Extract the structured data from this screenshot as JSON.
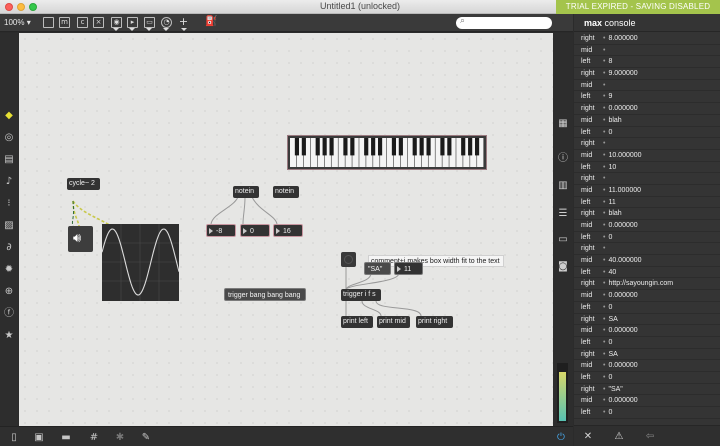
{
  "window": {
    "title": "Untitled1 (unlocked)",
    "trial_banner": "TRIAL EXPIRED - SAVING DISABLED"
  },
  "toolbar": {
    "zoom": "100%"
  },
  "patch": {
    "cycle": "cycle~ 2",
    "notein1": "notein",
    "notein2": "notein",
    "num1": "-8",
    "num2": "0",
    "num3": "16",
    "comment": "comment+j makes box width fit to the text",
    "msg_sa": "\"SA\"",
    "num_11": "11",
    "msg_trigger_bang": "trigger bang bang bang",
    "trigger": "trigger i f s",
    "print_left": "print left",
    "print_mid": "print mid",
    "print_right": "print right"
  },
  "console": {
    "title_bold": "max",
    "title_rest": " console",
    "rows": [
      {
        "src": "right",
        "val": "8.000000"
      },
      {
        "src": "mid",
        "val": ""
      },
      {
        "src": "left",
        "val": "8"
      },
      {
        "src": "right",
        "val": "9.000000"
      },
      {
        "src": "mid",
        "val": ""
      },
      {
        "src": "left",
        "val": "9"
      },
      {
        "src": "right",
        "val": "0.000000"
      },
      {
        "src": "mid",
        "val": "blah"
      },
      {
        "src": "left",
        "val": "0"
      },
      {
        "src": "right",
        "val": ""
      },
      {
        "src": "mid",
        "val": "10.000000"
      },
      {
        "src": "left",
        "val": "10"
      },
      {
        "src": "right",
        "val": ""
      },
      {
        "src": "mid",
        "val": "11.000000"
      },
      {
        "src": "left",
        "val": "11"
      },
      {
        "src": "right",
        "val": "blah"
      },
      {
        "src": "mid",
        "val": "0.000000"
      },
      {
        "src": "left",
        "val": "0"
      },
      {
        "src": "right",
        "val": ""
      },
      {
        "src": "mid",
        "val": "40.000000"
      },
      {
        "src": "left",
        "val": "40"
      },
      {
        "src": "right",
        "val": "http://sayoungin.com"
      },
      {
        "src": "mid",
        "val": "0.000000"
      },
      {
        "src": "left",
        "val": "0"
      },
      {
        "src": "right",
        "val": "SA"
      },
      {
        "src": "mid",
        "val": "0.000000"
      },
      {
        "src": "left",
        "val": "0"
      },
      {
        "src": "right",
        "val": "SA"
      },
      {
        "src": "mid",
        "val": "0.000000"
      },
      {
        "src": "left",
        "val": "0"
      },
      {
        "src": "right",
        "val": "\"SA\""
      },
      {
        "src": "mid",
        "val": "0.000000"
      },
      {
        "src": "left",
        "val": "0"
      }
    ]
  },
  "icons": {
    "left_sidebar": [
      "cube-icon",
      "circle-icon",
      "film-icon",
      "music-note-icon",
      "bracket-icon",
      "image-icon",
      "paperclip-icon",
      "gear-icon",
      "plug-icon",
      "info-icon",
      "star-icon"
    ],
    "right_sidebar": [
      "grid-icon",
      "info-icon",
      "book-icon",
      "list-icon",
      "columns-icon",
      "camera-icon"
    ],
    "bottom": [
      "lock-icon",
      "present-icon",
      "comment-icon",
      "grid-icon",
      "debug-icon",
      "wrench-icon"
    ]
  },
  "meter": {
    "level": 0.87
  }
}
